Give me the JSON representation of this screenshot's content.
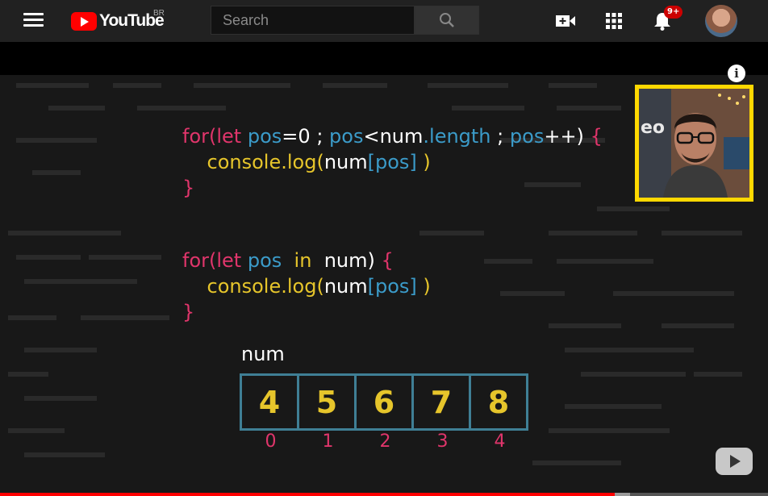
{
  "header": {
    "logo_text": "YouTube",
    "logo_region": "BR",
    "search_placeholder": "Search",
    "notification_count": "9+",
    "icons": [
      "menu-icon",
      "search-icon",
      "create-video-icon",
      "apps-grid-icon",
      "bell-icon"
    ]
  },
  "video": {
    "code_loop1": {
      "line1": {
        "for": "for",
        "paren": "(",
        "let": "let",
        "pos": "pos",
        "eq": "=0",
        "semi1": ";",
        "pos2": "pos",
        "lt": "<num",
        "length": ".length",
        "semi2": ";",
        "pos3": "pos",
        "inc": "++)",
        "brace": "{"
      },
      "line2": {
        "console": "console.log(",
        "num": "num",
        "bracket": "[pos]",
        "close": ")"
      },
      "line3": "}"
    },
    "code_loop2": {
      "line1": {
        "for": "for",
        "paren": "(",
        "let": "let",
        "pos": "pos",
        "in": "in",
        "num": "num",
        "close": ")",
        "brace": "{"
      },
      "line2": {
        "console": "console.log(",
        "num": "num",
        "bracket": "[pos]",
        "close": ")"
      },
      "line3": "}"
    },
    "array_label": "num",
    "array_values": [
      "4",
      "5",
      "6",
      "7",
      "8"
    ],
    "array_indices": [
      "0",
      "1",
      "2",
      "3",
      "4"
    ],
    "info_icon": "i",
    "progress_fraction": 0.8,
    "buffer_fraction": 0.82
  },
  "colors": {
    "keyword": "#e0356b",
    "variable": "#3b9bc9",
    "function": "#e6c52b",
    "frame": "#ffd800",
    "progress": "#ff0000"
  }
}
